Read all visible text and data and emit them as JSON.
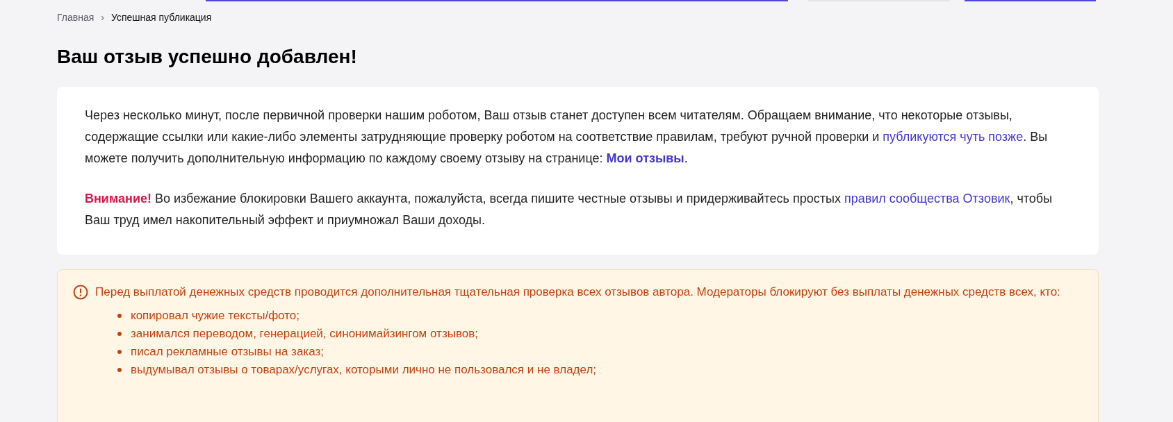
{
  "breadcrumbs": [
    {
      "label": "Главная",
      "kind": "link"
    },
    {
      "label": "›",
      "kind": "separator"
    },
    {
      "label": "Успешная публикация",
      "kind": "current"
    }
  ],
  "title": "Ваш отзыв успешно добавлен!",
  "message": {
    "paragraphs": [
      [
        {
          "kind": "text",
          "text": "Через несколько минут, после первичной проверки нашим роботом, Ваш отзыв станет доступен всем читателям. Обращаем внимание, что некоторые отзывы, содержащие ссылки или какие-либо элементы затрудняющие проверку роботом на соответствие правилам, требуют ручной проверки и "
        },
        {
          "kind": "link",
          "text": "публикуются чуть позже"
        },
        {
          "kind": "text",
          "text": ". Вы можете получить дополнительную информацию по каждому своему отзыву на странице: "
        },
        {
          "kind": "strong-link",
          "text": "Мои отзывы"
        },
        {
          "kind": "text",
          "text": "."
        }
      ],
      [
        {
          "kind": "alert",
          "text": "Внимание!"
        },
        {
          "kind": "text",
          "text": " Во избежание блокировки Вашего аккаунта, пожалуйста, всегда пишите честные отзывы и придерживайтесь простых "
        },
        {
          "kind": "link",
          "text": "правил сообщества Отзовик"
        },
        {
          "kind": "text",
          "text": ", чтобы Ваш труд имел накопительный эффект и приумножал Ваши доходы."
        }
      ]
    ]
  },
  "warning": {
    "text": "Перед выплатой денежных средств проводится дополнительная тщательная проверка всех отзывов автора. Модераторы блокируют без выплаты денежных средств всех, кто:",
    "items": [
      "копировал чужие тексты/фото;",
      "занимался переводом, генерацией, синонимайзингом отзывов;",
      "писал рекламные отзывы на заказ;",
      "выдумывал отзывы о товарах/услугах, которыми лично не пользовался и не владел;"
    ]
  }
}
